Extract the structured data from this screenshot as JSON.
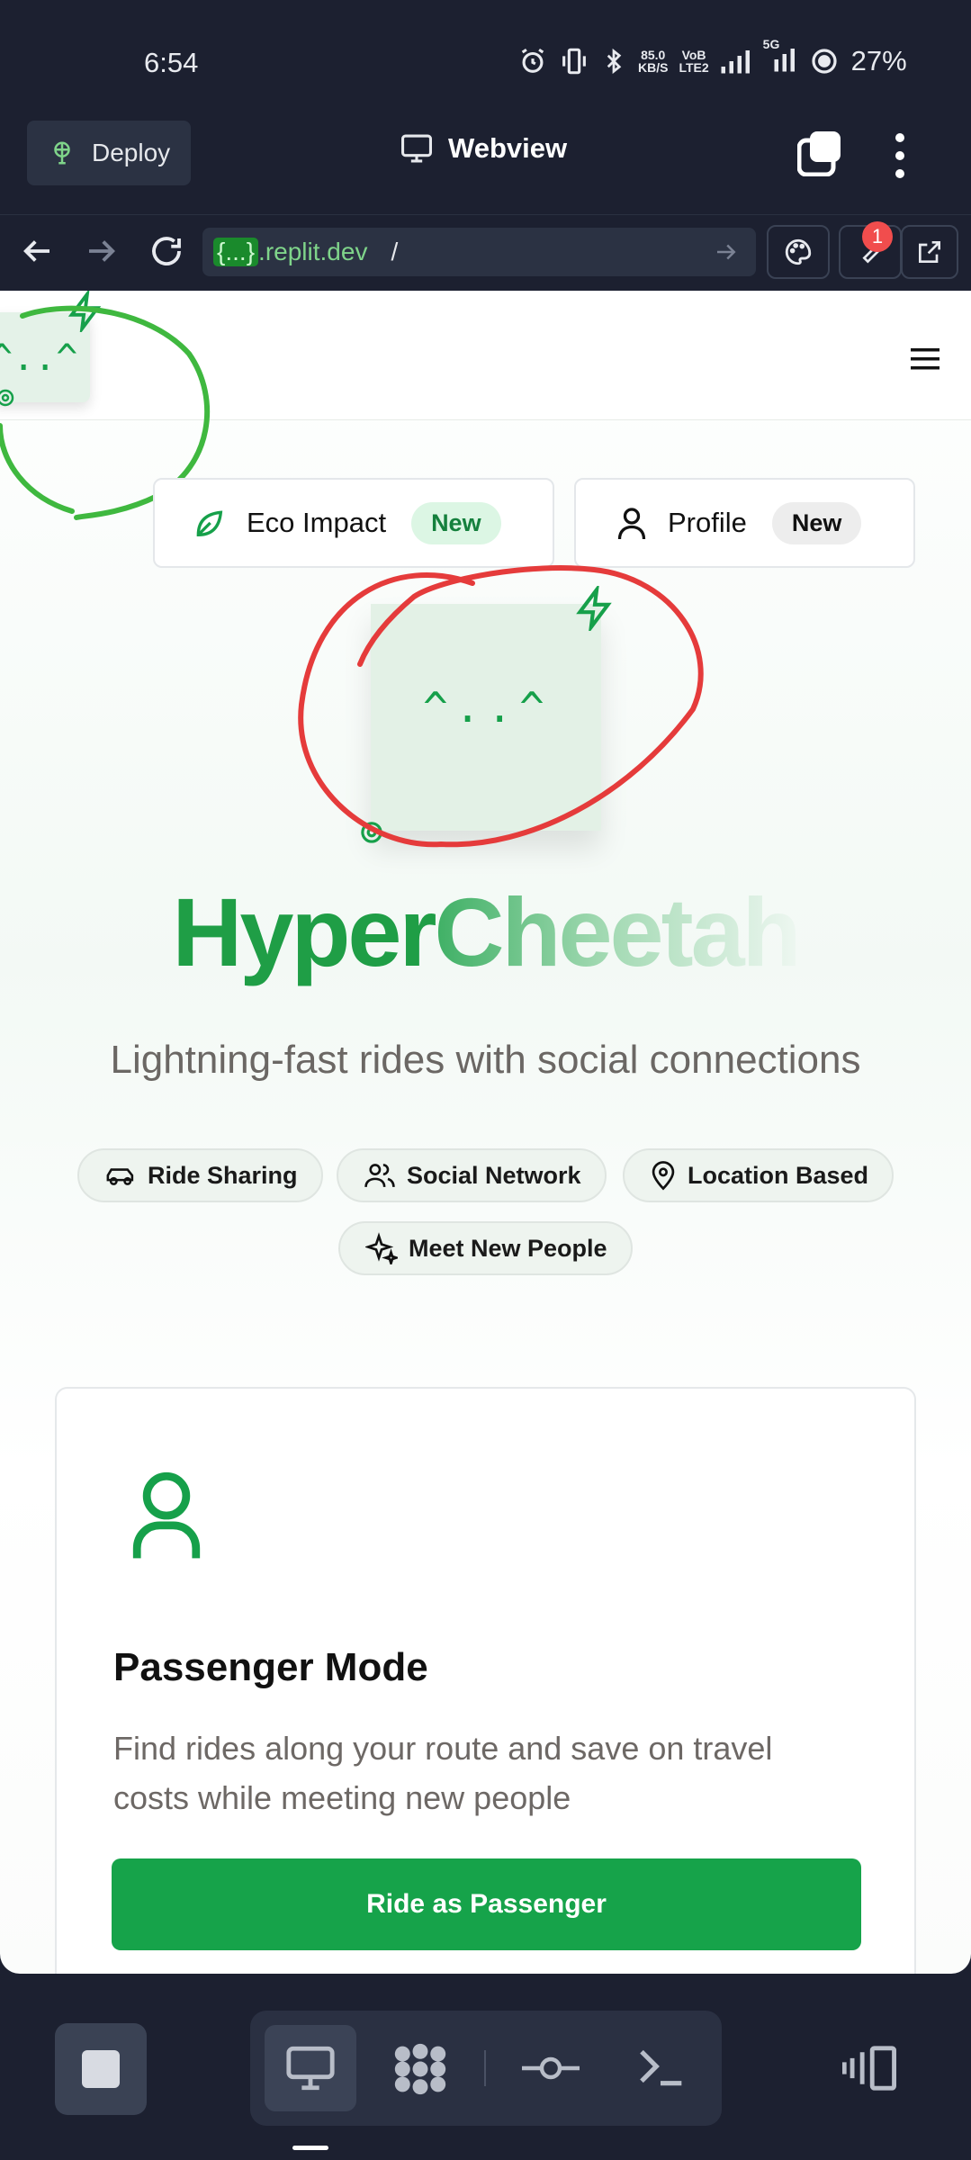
{
  "status_bar": {
    "time": "6:54",
    "net_speed_top": "85.0",
    "net_speed_bottom": "KB/S",
    "volte_top": "VoB",
    "volte_bottom": "LTE2",
    "network": "5G",
    "battery": "27%"
  },
  "toolbar": {
    "deploy_label": "Deploy",
    "webview_label": "Webview"
  },
  "url_bar": {
    "host_badge": "{...}",
    "domain": ".replit.dev",
    "path": "/",
    "badge_count": "1"
  },
  "app": {
    "header_menu": "menu",
    "nav_pills": [
      {
        "label": "Eco Impact",
        "badge": "New"
      },
      {
        "label": "Profile",
        "badge": "New"
      }
    ],
    "logo_face": "^..^",
    "title_part1": "Hyper",
    "title_part2": "Cheetah",
    "subtitle": "Lightning-fast rides with social connections",
    "chips": [
      "Ride Sharing",
      "Social Network",
      "Location Based",
      "Meet New People"
    ],
    "mode_card": {
      "title": "Passenger Mode",
      "description": "Find rides along your route and save on travel costs while meeting new people",
      "button": "Ride as Passenger"
    }
  },
  "colors": {
    "brand_green": "#16a34a",
    "annotation_green": "#3fb83f",
    "annotation_red": "#e53b3b",
    "ide_bg": "#1c2030"
  }
}
